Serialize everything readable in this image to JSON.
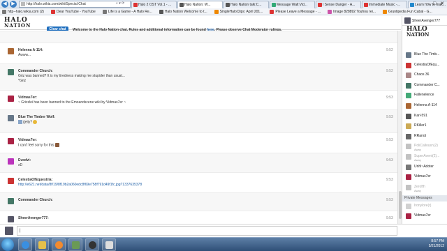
{
  "browser": {
    "url": "http://halo.wikia.com/wiki/Special:Chat",
    "window_controls": "– □ ✕",
    "tabs": [
      {
        "label": "Halo 2 OST Vol.1 - ...",
        "color": "#d33",
        "active": false
      },
      {
        "label": "Halo Nation: W...",
        "color": "#555",
        "active": true
      },
      {
        "label": "Halo Nation talk:C...",
        "color": "#555",
        "active": false
      },
      {
        "label": "Message Wall:Vid...",
        "color": "#3a7",
        "active": false
      },
      {
        "label": "I Sense Danger - A...",
        "color": "#d33",
        "active": false
      },
      {
        "label": "Immediate Music -...",
        "color": "#d33",
        "active": false
      },
      {
        "label": "Learn how to mak...",
        "color": "#28c",
        "active": false
      }
    ],
    "favorites": [
      {
        "label": "http--halo.wikia.com (2)",
        "color": "#777"
      },
      {
        "label": "Dear YouTube - YouTube",
        "color": "#d33"
      },
      {
        "label": "Life is a Game - A Halo Re...",
        "color": "#777"
      },
      {
        "label": "Halo Nation Welcome to t...",
        "color": "#555"
      },
      {
        "label": "SingleHaloClips: April 201...",
        "color": "#e80"
      },
      {
        "label": "Please Leave a Message - ...",
        "color": "#d33"
      },
      {
        "label": "Image 828892 Touhou rei...",
        "color": "#c5a"
      },
      {
        "label": "Gruntipedia Fun Cabal - G...",
        "color": "#e80"
      }
    ]
  },
  "header": {
    "logo_top": "HALO",
    "logo_bottom": "NATION",
    "clear_chat_label": "Clear chat",
    "welcome_prefix": "Welcome to the Halo Nation chat. Rules and additional information can be found ",
    "welcome_link": "here",
    "welcome_suffix": ". Please observe Chat Moderator rulings."
  },
  "messages": [
    {
      "user": "",
      "lines": [
        "Awww..."
      ],
      "time": "",
      "partial": true
    },
    {
      "user": "Helenna A-114:",
      "lines": [
        "Awww..."
      ],
      "time": "9:52",
      "color": "#a63"
    },
    {
      "user": "Commander Church:",
      "lines": [
        "Griz was banned? It is my tiredness making me stupider than usual...",
        "*Griz"
      ],
      "time": "9:52",
      "color": "#476"
    },
    {
      "user": "Vidmas7er:",
      "lines": [
        "~ Grizzlei has been banned to the Emoandscene wiki by Vidmas7er ~"
      ],
      "time": "9:53",
      "color": "#a24"
    },
    {
      "user": "Blue The Timber Wolf:",
      "lines": [
        "(jelly?"
      ],
      "time": "9:53",
      "color": "#678"
    },
    {
      "user": "Vidmas7er:",
      "lines": [
        "I can't feel sorry for this"
      ],
      "time": "9:53",
      "color": "#a24"
    },
    {
      "user": "Evodvi:",
      "lines": [
        "xD"
      ],
      "time": "9:53",
      "color": "#b3b"
    },
    {
      "user": "CelestiaOfEquestria:",
      "lines": [
        "http://e621.net/data/8f/19/8f19b2a060edc8f69e758f791d49f1fc.jpg?1337635378"
      ],
      "time": "9:53",
      "color": "#c33",
      "link": true
    },
    {
      "user": "Commander Church:",
      "lines": [
        ""
      ],
      "time": "9:53",
      "color": "#476"
    },
    {
      "user": "SheerAvenger777:",
      "lines": [
        ""
      ],
      "time": "9:53",
      "color": "#556"
    }
  ],
  "sidebar": {
    "me": "SheerAvenger777",
    "logo_top": "HALO",
    "logo_bottom": "NATION",
    "users": [
      {
        "name": "Blue The Timb...",
        "status": "",
        "color": "#678",
        "away": false
      },
      {
        "name": "CelestiaOfEqu...",
        "status": "",
        "color": "#c33",
        "away": false
      },
      {
        "name": "Chaos 36",
        "status": "",
        "color": "#a88",
        "away": false
      },
      {
        "name": "Commander C...",
        "status": "",
        "color": "#476",
        "away": false
      },
      {
        "name": "Fallenelence",
        "status": "",
        "color": "#4a7",
        "away": false
      },
      {
        "name": "Helenna A-114",
        "status": "",
        "color": "#a63",
        "away": false
      },
      {
        "name": "Karl-591",
        "status": "",
        "color": "#555",
        "away": false
      },
      {
        "name": "RKiller1",
        "status": "",
        "color": "#ca5",
        "away": false
      },
      {
        "name": "RRanot",
        "status": "",
        "color": "#666",
        "away": false
      },
      {
        "name": "PoliCallousn(2)",
        "status": "Away",
        "color": "#777",
        "away": true
      },
      {
        "name": "SuperAvent(2)...",
        "status": "Away",
        "color": "#777",
        "away": true
      },
      {
        "name": "Unhl~Adoter",
        "status": "",
        "color": "#777",
        "away": false
      },
      {
        "name": "Vidmas7er",
        "status": "",
        "color": "#a24",
        "away": false
      },
      {
        "name": "Zerofth",
        "status": "Away",
        "color": "#777",
        "away": true
      }
    ],
    "pm_header": "Private Messages",
    "pm_users": [
      {
        "name": "Ironylore(r)",
        "color": "#999",
        "away": true
      },
      {
        "name": "Vidmas7er",
        "color": "#a24",
        "away": false
      }
    ]
  },
  "input": {
    "value": "|"
  },
  "taskbar": {
    "time": "8:57 PM",
    "date": "5/21/2012"
  }
}
